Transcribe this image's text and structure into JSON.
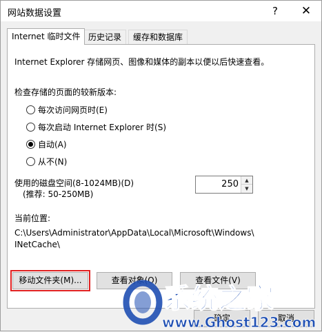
{
  "window": {
    "title": "网站数据设置",
    "help_icon": "?",
    "close_icon": "✕"
  },
  "tabs": [
    {
      "label": "Internet 临时文件",
      "active": true
    },
    {
      "label": "历史记录",
      "active": false
    },
    {
      "label": "缓存和数据库",
      "active": false
    }
  ],
  "panel": {
    "description": "Internet Explorer 存储网页、图像和媒体的副本以便以后快速查看。",
    "check_label": "检查存储的页面的较新版本:",
    "radios": [
      {
        "label": "每次访问网页时(E)",
        "checked": false
      },
      {
        "label": "每次启动 Internet Explorer 时(S)",
        "checked": false
      },
      {
        "label": "自动(A)",
        "checked": true
      },
      {
        "label": "从不(N)",
        "checked": false
      }
    ],
    "disk_label": "使用的磁盘空间(8-1024MB)(D)",
    "disk_recommend": "(推荐: 50-250MB)",
    "disk_value": "250",
    "location_label": "当前位置:",
    "location_line1": "C:\\Users\\Administrator\\AppData\\Local\\Microsoft\\Windows\\",
    "location_line2": "INetCache\\"
  },
  "buttons": {
    "move_folder": "移动文件夹(M)...",
    "view_objects": "查看对象(O)",
    "view_files": "查看文件(V)",
    "ok": "确定",
    "cancel": "取消"
  },
  "watermark": {
    "brand": "系统之家",
    "url": "www.Ghost123.com"
  }
}
